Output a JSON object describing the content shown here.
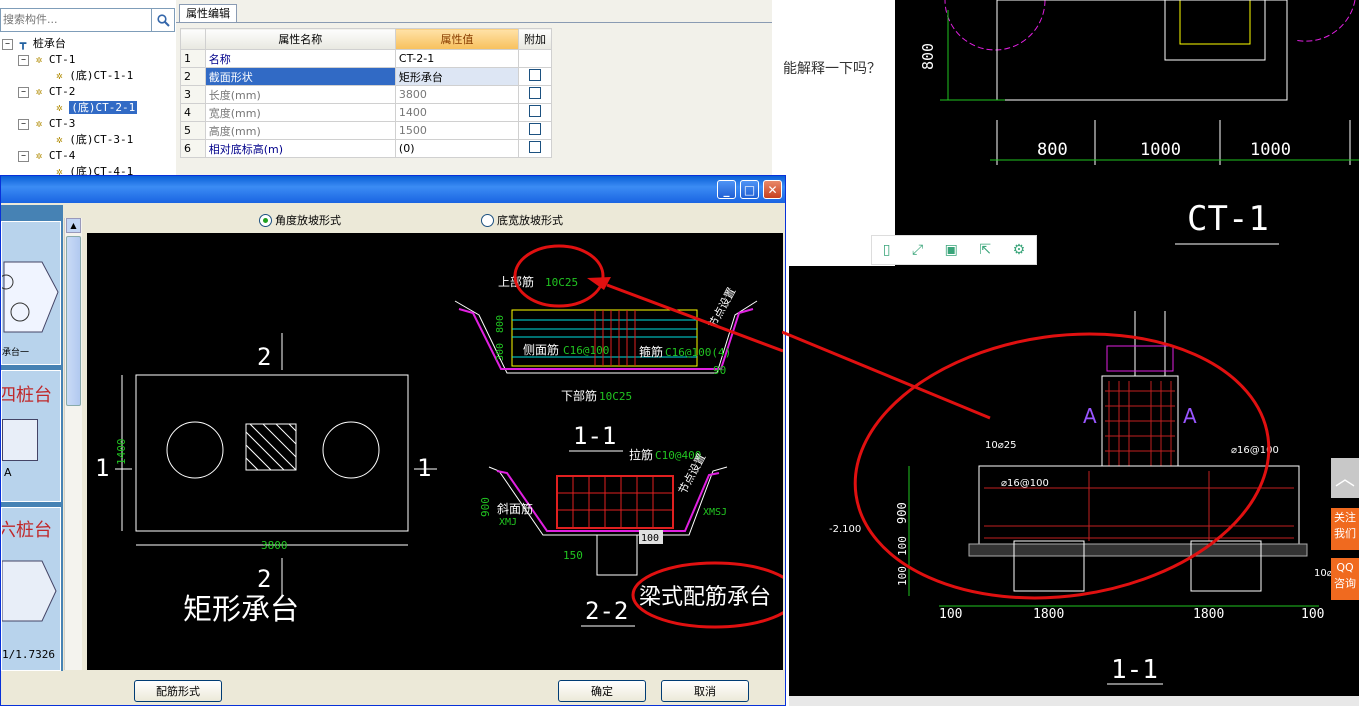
{
  "tree": {
    "search_placeholder": "搜索构件...",
    "items": [
      {
        "label": "桩承台",
        "level": 0
      },
      {
        "label": "CT-1",
        "level": 1
      },
      {
        "label": "(底)CT-1-1",
        "level": 2
      },
      {
        "label": "CT-2",
        "level": 1
      },
      {
        "label": "(底)CT-2-1",
        "level": 2,
        "selected": true
      },
      {
        "label": "CT-3",
        "level": 1
      },
      {
        "label": "(底)CT-3-1",
        "level": 2
      },
      {
        "label": "CT-4",
        "level": 1
      },
      {
        "label": "(底)CT-4-1",
        "level": 2
      }
    ]
  },
  "properties": {
    "tab_label": "属性编辑",
    "headers": {
      "name": "属性名称",
      "value": "属性值",
      "extra": "附加"
    },
    "rows": [
      {
        "num": "1",
        "name": "名称",
        "value": "CT-2-1",
        "has_check": false
      },
      {
        "num": "2",
        "name": "截面形状",
        "value": "矩形承台",
        "has_check": true
      },
      {
        "num": "3",
        "name": "长度(mm)",
        "value": "3800",
        "has_check": true
      },
      {
        "num": "4",
        "name": "宽度(mm)",
        "value": "1400",
        "has_check": true
      },
      {
        "num": "5",
        "name": "高度(mm)",
        "value": "1500",
        "has_check": true
      },
      {
        "num": "6",
        "name": "相对底标高(m)",
        "value": "(0)",
        "has_check": true
      }
    ]
  },
  "dialog": {
    "radio_options": [
      "角度放坡形式",
      "底宽放坡形式"
    ],
    "selected_radio": 0,
    "buttons": {
      "rebar_form": "配筋形式",
      "ok": "确定",
      "cancel": "取消"
    },
    "left_thumbs": [
      {
        "label": "承台一"
      },
      {
        "label": "四桩台"
      },
      {
        "label": "A"
      },
      {
        "label": "六桩台"
      },
      {
        "label": "1/1.7326"
      }
    ]
  },
  "cad": {
    "plan_label": "矩形承台",
    "plan_length": "3800",
    "plan_width": "1400",
    "cut1": "1",
    "cut2": "2",
    "section11_title": "1-1",
    "section22_title": "2-2",
    "top_rebar_label": "上部筋",
    "top_rebar_value": "10C25",
    "side_rebar_label": "侧面筋",
    "side_rebar_value": "C16@100",
    "stirrup_label": "箍筋",
    "stirrup_value": "C16@100(4)",
    "bottom_rebar_label": "下部筋",
    "bottom_rebar_value": "10C25",
    "tie_label": "拉筋",
    "tie_value": "C10@400",
    "slope_rebar_label": "斜面筋",
    "slope_left": "XMJ",
    "slope_right": "XMSJ",
    "dim_800": "800",
    "dim_300": "300",
    "dim_900": "900",
    "dim_150": "150",
    "dim_100": "100",
    "angle": "90",
    "joint_label": "节点设置",
    "annotation": "梁式配筋承台"
  },
  "right": {
    "question": "能解释一下吗？",
    "top_dims": [
      "800",
      "1000",
      "1000"
    ],
    "top_vertical_dim": "800",
    "top_title": "CT-1",
    "bottom_title": "1-1",
    "bottom_dims": [
      "100",
      "1800",
      "1800",
      "100"
    ],
    "labels": {
      "rebar_top": "10⌀25",
      "rebar_side": "⌀16@100",
      "rebar_right": "⌀16@100",
      "elev": "-2.100",
      "h900": "900",
      "h100a": "100",
      "h100b": "100",
      "sectionA": "A",
      "right_rebar_cut": "10⌀"
    }
  },
  "side_widgets": {
    "follow": "关注我们",
    "qq": "QQ咨询"
  }
}
